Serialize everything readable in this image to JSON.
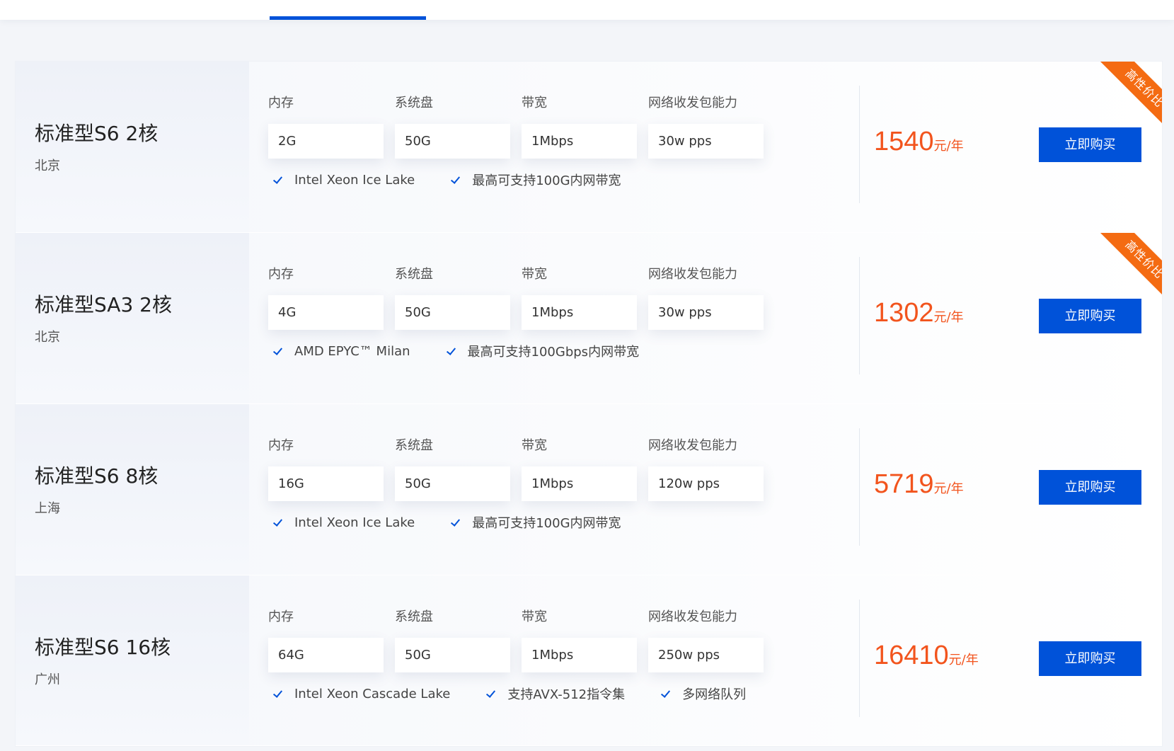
{
  "products": [
    {
      "title": "标准型S6 2核",
      "region": "北京",
      "specs": [
        {
          "label": "内存",
          "value": "2G"
        },
        {
          "label": "系统盘",
          "value": "50G"
        },
        {
          "label": "带宽",
          "value": "1Mbps"
        },
        {
          "label": "网络收发包能力",
          "value": "30w pps"
        }
      ],
      "features": [
        "Intel Xeon Ice Lake",
        "最高可支持100G内网带宽"
      ],
      "price": "1540",
      "unit": "元/年",
      "buy_label": "立即购买",
      "badge": "高性价比"
    },
    {
      "title": "标准型SA3 2核",
      "region": "北京",
      "specs": [
        {
          "label": "内存",
          "value": "4G"
        },
        {
          "label": "系统盘",
          "value": "50G"
        },
        {
          "label": "带宽",
          "value": "1Mbps"
        },
        {
          "label": "网络收发包能力",
          "value": "30w pps"
        }
      ],
      "features": [
        "AMD EPYC™ Milan",
        "最高可支持100Gbps内网带宽"
      ],
      "price": "1302",
      "unit": "元/年",
      "buy_label": "立即购买",
      "badge": "高性价比"
    },
    {
      "title": "标准型S6 8核",
      "region": "上海",
      "specs": [
        {
          "label": "内存",
          "value": "16G"
        },
        {
          "label": "系统盘",
          "value": "50G"
        },
        {
          "label": "带宽",
          "value": "1Mbps"
        },
        {
          "label": "网络收发包能力",
          "value": "120w pps"
        }
      ],
      "features": [
        "Intel Xeon Ice Lake",
        "最高可支持100G内网带宽"
      ],
      "price": "5719",
      "unit": "元/年",
      "buy_label": "立即购买"
    },
    {
      "title": "标准型S6 16核",
      "region": "广州",
      "specs": [
        {
          "label": "内存",
          "value": "64G"
        },
        {
          "label": "系统盘",
          "value": "50G"
        },
        {
          "label": "带宽",
          "value": "1Mbps"
        },
        {
          "label": "网络收发包能力",
          "value": "250w pps"
        }
      ],
      "features": [
        "Intel Xeon Cascade Lake",
        "支持AVX-512指令集",
        "多网络队列"
      ],
      "price": "16410",
      "unit": "元/年",
      "buy_label": "立即购买"
    }
  ],
  "colors": {
    "accent": "#0052d9",
    "price": "#f2541d",
    "badge": "#f46b12"
  }
}
